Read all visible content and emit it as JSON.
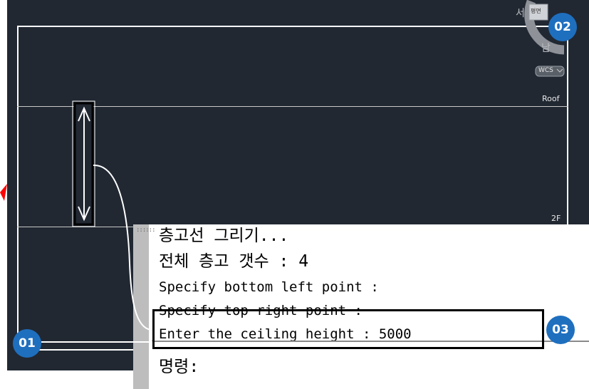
{
  "viewport": {
    "levels": [
      {
        "label": "Roof"
      },
      {
        "label": "2F"
      }
    ],
    "viewcube": {
      "west_label": "서",
      "top_label": "평면",
      "south_label": "남",
      "wcs_label": "WCS"
    }
  },
  "callouts": {
    "c1": "01",
    "c2": "02",
    "c3": "03"
  },
  "console": {
    "lines": [
      "층고선 그리기...",
      "전체 층고 갯수 : 4",
      "Specify bottom left point :",
      "Specify top right point :",
      "Enter the ceiling height : 5000"
    ],
    "prompt": "명령:"
  },
  "colors": {
    "viewport_bg": "#212832",
    "callout": "#1f6fbf",
    "annotation": "#ff0000"
  }
}
